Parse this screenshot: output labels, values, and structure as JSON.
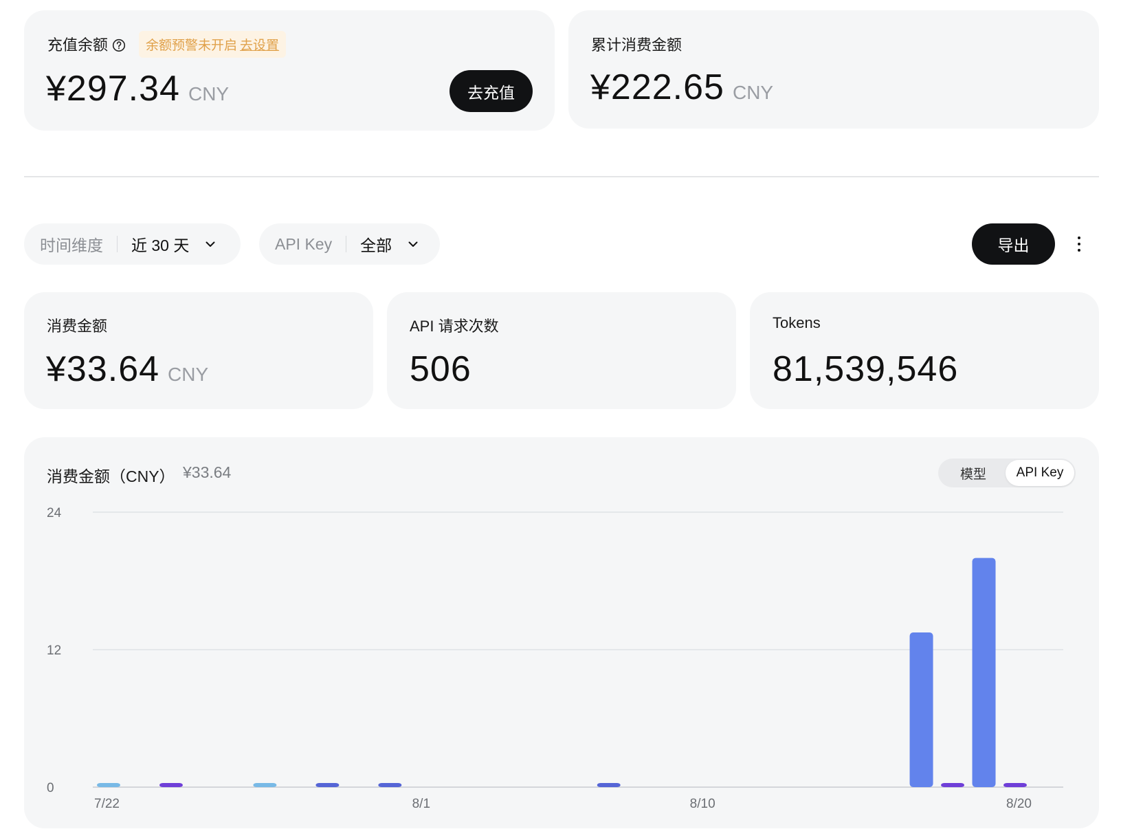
{
  "balance_card": {
    "label": "充值余额",
    "warning_text": "余额预警未开启",
    "warning_link": "去设置",
    "amount": "¥297.34",
    "currency": "CNY",
    "recharge_button": "去充值"
  },
  "total_spend_card": {
    "label": "累计消费金额",
    "amount": "¥222.65",
    "currency": "CNY"
  },
  "filters": {
    "time": {
      "label": "时间维度",
      "value": "近 30 天"
    },
    "apikey": {
      "label": "API Key",
      "value": "全部"
    },
    "export_button": "导出"
  },
  "stats": {
    "spend": {
      "label": "消费金额",
      "value": "¥33.64",
      "currency": "CNY"
    },
    "requests": {
      "label": "API 请求次数",
      "value": "506"
    },
    "tokens": {
      "label": "Tokens",
      "value": "81,539,546"
    }
  },
  "chart_section": {
    "title": "消费金额（CNY）",
    "total": "¥33.64",
    "toggle": {
      "model": "模型",
      "apikey": "API Key",
      "selected": "API Key"
    }
  },
  "colors": {
    "blue": "#6283ec",
    "purple": "#6f3fd8",
    "indigo": "#5565d6",
    "lightblue": "#78b9e6"
  },
  "chart_data": {
    "type": "bar",
    "ylim": [
      0,
      24
    ],
    "y_ticks": [
      "0",
      "12",
      "24"
    ],
    "grid": true,
    "x_tick_labels": [
      {
        "day": 0,
        "label": "7/22"
      },
      {
        "day": 10,
        "label": "8/1"
      },
      {
        "day": 19,
        "label": "8/10"
      },
      {
        "day": 29,
        "label": "8/20"
      }
    ],
    "bars": [
      {
        "day": 0,
        "value": 0.3,
        "color": "#78b9e6"
      },
      {
        "day": 2,
        "value": 0.3,
        "color": "#6f3fd8"
      },
      {
        "day": 5,
        "value": 0.3,
        "color": "#78b9e6"
      },
      {
        "day": 7,
        "value": 0.3,
        "color": "#5565d6"
      },
      {
        "day": 9,
        "value": 0.3,
        "color": "#5565d6"
      },
      {
        "day": 16,
        "value": 0.3,
        "color": "#5565d6"
      },
      {
        "day": 26,
        "value": 13.5,
        "color": "#6283ec"
      },
      {
        "day": 27,
        "value": 0.3,
        "color": "#6f3fd8"
      },
      {
        "day": 28,
        "value": 20,
        "color": "#6283ec"
      },
      {
        "day": 29,
        "value": 0.3,
        "color": "#6f3fd8"
      }
    ]
  }
}
